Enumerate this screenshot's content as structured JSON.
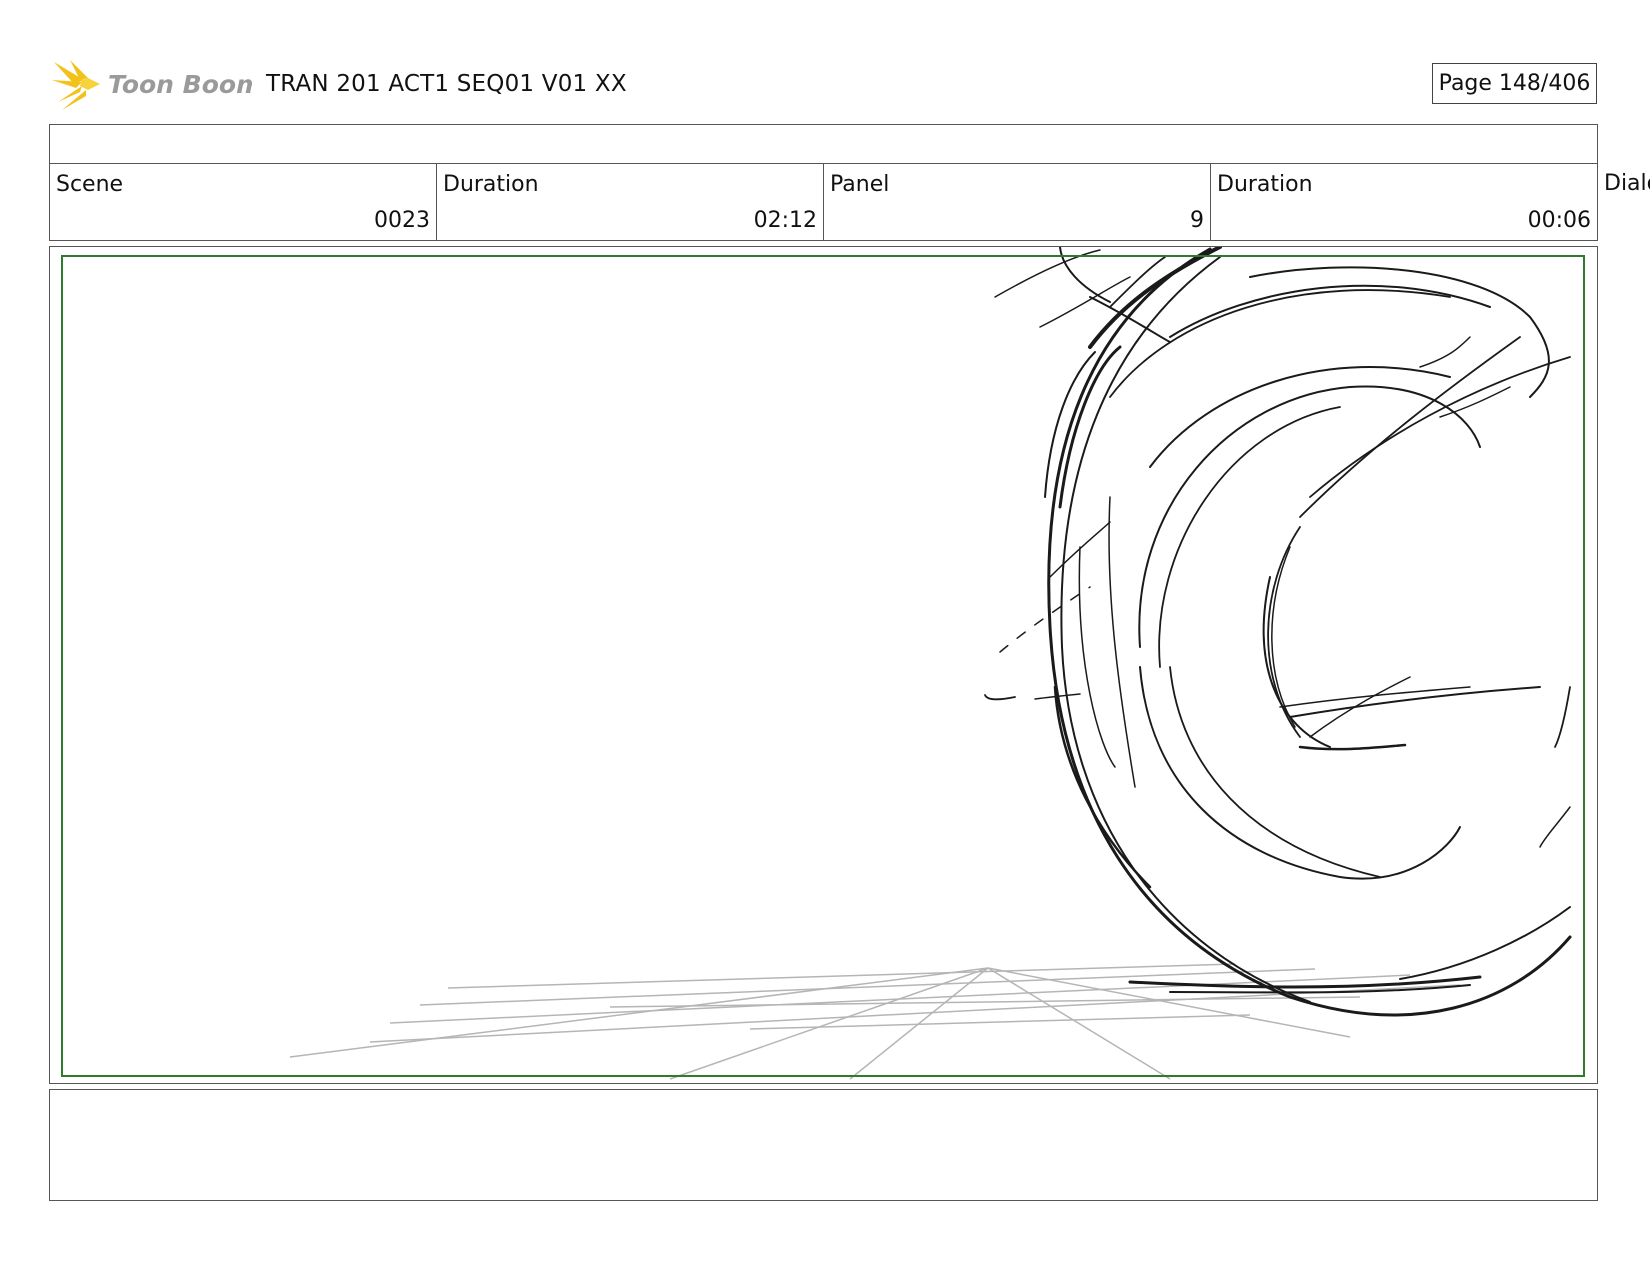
{
  "header": {
    "logo_text": "Toon Boom",
    "title": "TRAN 201 ACT1 SEQ01 V01 XX",
    "page_label": "Page 148/406"
  },
  "info": {
    "scene_label": "Scene",
    "scene_value": "0023",
    "scene_duration_label": "Duration",
    "scene_duration_value": "02:12",
    "panel_label": "Panel",
    "panel_value": "9",
    "panel_duration_label": "Duration",
    "panel_duration_value": "00:06",
    "dialog_label": "Dialo"
  },
  "colors": {
    "safe_frame": "#2e7a2e",
    "logo_burst": "#f2c21b",
    "logo_text": "#9a9a9a",
    "sketch_ink": "#1a1a1a",
    "guide_lines": "#b5b5b5"
  }
}
